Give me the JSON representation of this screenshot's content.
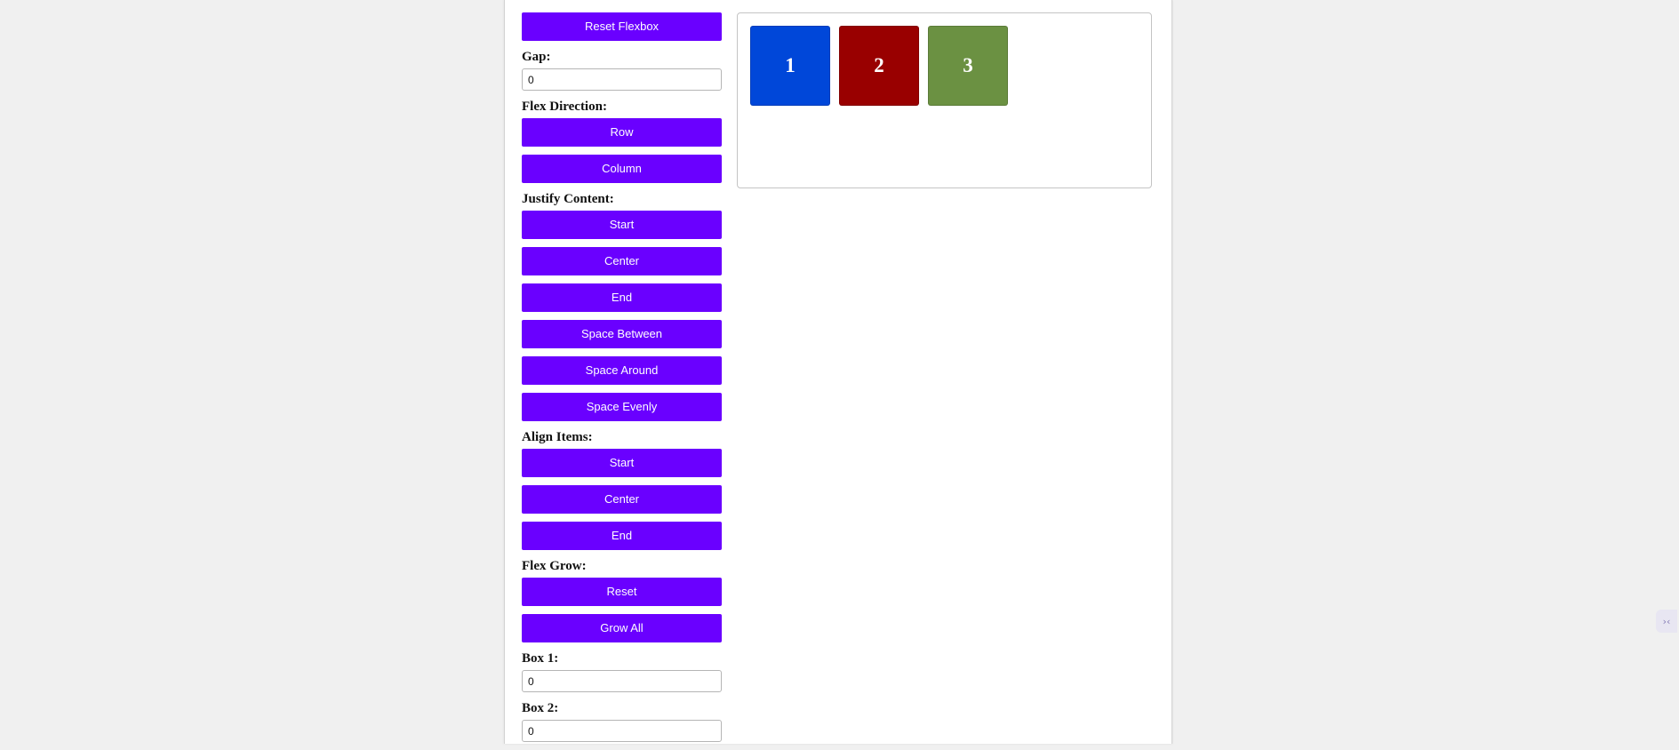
{
  "controls": {
    "reset_flexbox": "Reset Flexbox",
    "gap_label": "Gap:",
    "gap_value": "0",
    "flex_direction_label": "Flex Direction:",
    "row": "Row",
    "column": "Column",
    "justify_content_label": "Justify Content:",
    "justify_start": "Start",
    "justify_center": "Center",
    "justify_end": "End",
    "space_between": "Space Between",
    "space_around": "Space Around",
    "space_evenly": "Space Evenly",
    "align_items_label": "Align Items:",
    "align_start": "Start",
    "align_center": "Center",
    "align_end": "End",
    "flex_grow_label": "Flex Grow:",
    "grow_reset": "Reset",
    "grow_all": "Grow All",
    "box1_label": "Box 1:",
    "box1_value": "0",
    "box2_label": "Box 2:",
    "box2_value": "0"
  },
  "boxes": [
    {
      "label": "1",
      "color": "#0047d9"
    },
    {
      "label": "2",
      "color": "#990000"
    },
    {
      "label": "3",
      "color": "#6b9142"
    }
  ],
  "colors": {
    "accent": "#6a00ff",
    "page_bg": "#f0f0f0"
  },
  "side_widget": {
    "icon": "collapse-arrows-icon",
    "glyph": "›‹"
  }
}
